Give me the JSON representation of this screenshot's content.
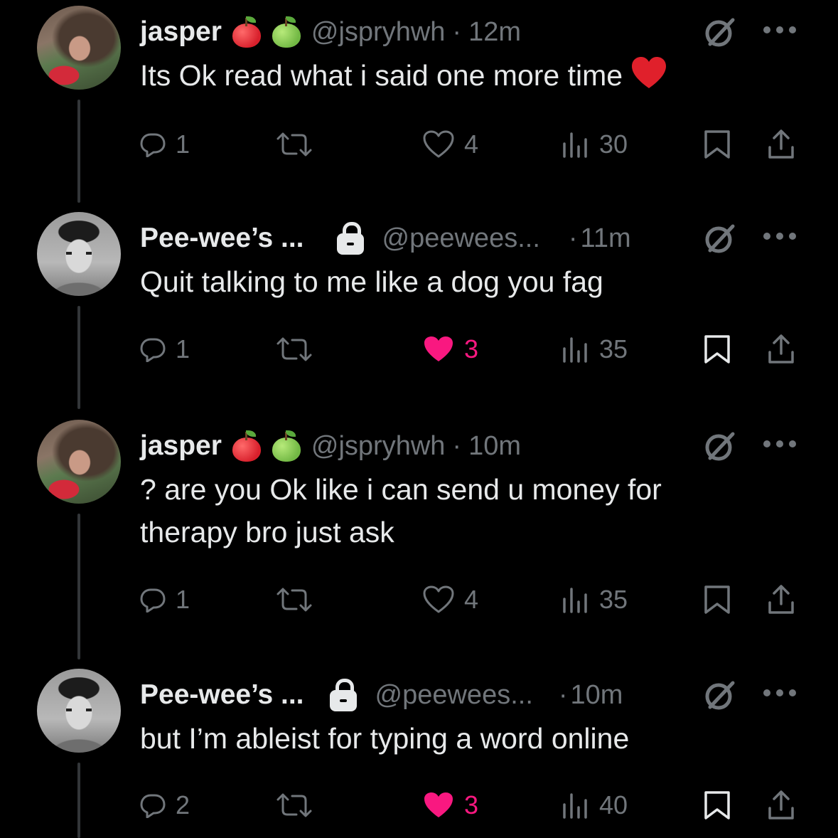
{
  "colors": {
    "background": "#000000",
    "text": "#e7e9ea",
    "muted": "#71767b",
    "like_active": "#f91880",
    "thread_line": "#333639"
  },
  "tweets": [
    {
      "name": "jasper",
      "name_emojis": [
        "red-apple",
        "green-apple"
      ],
      "locked": false,
      "handle": "@jspryhwh",
      "time": "12m",
      "text": "Its Ok read what i said one more time",
      "text_emoji": "red-heart",
      "replies": "1",
      "likes": "4",
      "liked": false,
      "views": "30"
    },
    {
      "name": "Pee-wee’s ...",
      "name_emojis": [],
      "locked": true,
      "handle": "@peewees...",
      "time": "11m",
      "text": "Quit talking to me like a dog you fag",
      "replies": "1",
      "likes": "3",
      "liked": true,
      "views": "35"
    },
    {
      "name": "jasper",
      "name_emojis": [
        "red-apple",
        "green-apple"
      ],
      "locked": false,
      "handle": "@jspryhwh",
      "time": "10m",
      "text": "? are you Ok like i can send u money for therapy bro just ask",
      "replies": "1",
      "likes": "4",
      "liked": false,
      "views": "35"
    },
    {
      "name": "Pee-wee’s ...",
      "name_emojis": [],
      "locked": true,
      "handle": "@peewees...",
      "time": "10m",
      "text": "but I’m ableist for typing a word online",
      "replies": "2",
      "likes": "3",
      "liked": true,
      "views": "40"
    }
  ],
  "dot_separator": "·"
}
